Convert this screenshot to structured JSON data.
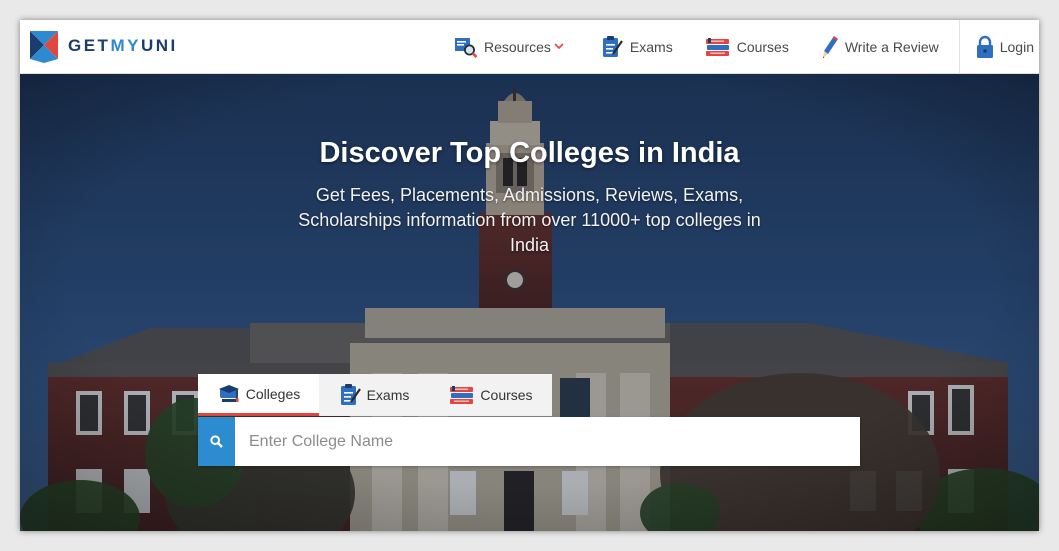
{
  "brand": {
    "part1": "GET",
    "part2": "MY",
    "part3": "UNI"
  },
  "nav": {
    "resources": "Resources",
    "exams": "Exams",
    "courses": "Courses",
    "review": "Write a Review",
    "login": "Login"
  },
  "hero": {
    "title": "Discover Top Colleges in India",
    "subtitle": "Get Fees, Placements, Admissions, Reviews, Exams, Scholarships information from over 11000+ top colleges in India"
  },
  "search": {
    "tabs": [
      {
        "label": "Colleges",
        "active": true
      },
      {
        "label": "Exams",
        "active": false
      },
      {
        "label": "Courses",
        "active": false
      }
    ],
    "placeholder": "Enter College Name",
    "value": ""
  },
  "colors": {
    "brand_dark": "#1b3d6e",
    "brand_blue": "#2e8ad0",
    "brand_red": "#e2463f",
    "search_button": "#2d8bd0"
  },
  "icons": {
    "logo": "getmyuni-x-logo",
    "resources": "resources-search-icon",
    "exams": "exam-clipboard-icon",
    "courses": "books-icon",
    "review": "pencil-icon",
    "login": "lock-icon",
    "search": "search-icon"
  }
}
